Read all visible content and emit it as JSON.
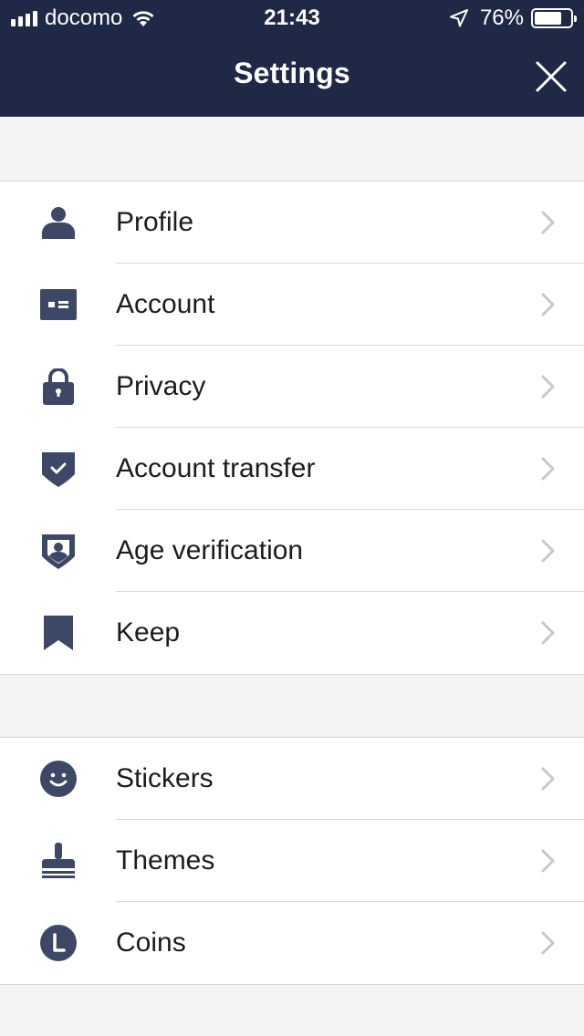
{
  "status_bar": {
    "carrier": "docomo",
    "time": "21:43",
    "battery": "76%",
    "battery_level": 0.76,
    "icons": [
      "signal-bars-icon",
      "wifi-icon",
      "location-arrow-icon",
      "battery-icon"
    ]
  },
  "header": {
    "title": "Settings",
    "close_icon": "close-icon",
    "background_color": "#1f2946"
  },
  "accent_color": "#3d4766",
  "groups": [
    {
      "items": [
        {
          "label": "Profile",
          "icon": "person-icon"
        },
        {
          "label": "Account",
          "icon": "id-card-icon"
        },
        {
          "label": "Privacy",
          "icon": "lock-icon"
        },
        {
          "label": "Account transfer",
          "icon": "shield-check-icon"
        },
        {
          "label": "Age verification",
          "icon": "shield-person-icon"
        },
        {
          "label": "Keep",
          "icon": "bookmark-icon"
        }
      ]
    },
    {
      "items": [
        {
          "label": "Stickers",
          "icon": "smiley-icon"
        },
        {
          "label": "Themes",
          "icon": "paint-brush-icon"
        },
        {
          "label": "Coins",
          "icon": "coin-icon"
        }
      ]
    }
  ]
}
